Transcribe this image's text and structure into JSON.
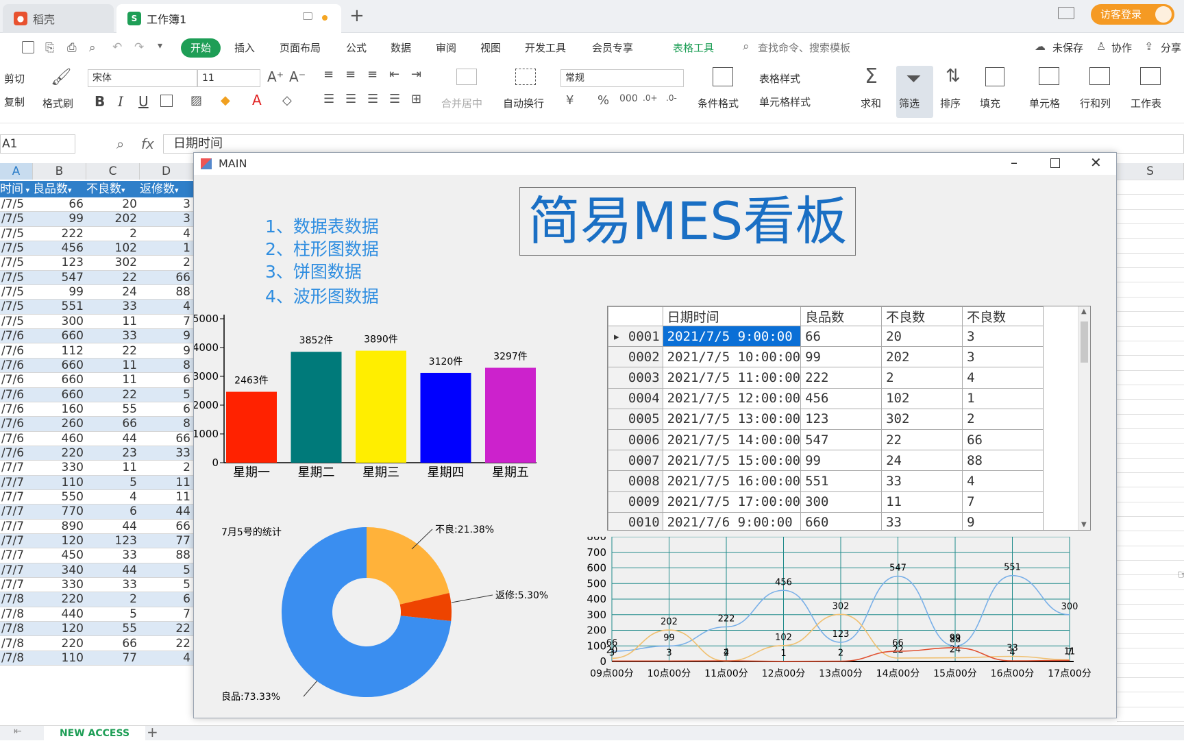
{
  "titlebar": {
    "tab1": "稻壳",
    "tab2": "工作簿1",
    "new_tab": "+",
    "login": "访客登录"
  },
  "menu": {
    "items": [
      "开始",
      "插入",
      "页面布局",
      "公式",
      "数据",
      "审阅",
      "视图",
      "开发工具",
      "会员专享",
      "表格工具"
    ],
    "search": "查找命令、搜索模板",
    "unsaved": "未保存",
    "collab": "协作",
    "share": "分享"
  },
  "toolbar": {
    "cut": "剪切",
    "copy": "复制",
    "format_painter": "格式刷",
    "font": "宋体",
    "size": "11",
    "merge": "合并居中",
    "wrap": "自动换行",
    "number_format": "常规",
    "cond_format": "条件格式",
    "table_style": "表格样式",
    "cell_style": "单元格样式",
    "sum": "求和",
    "filter": "筛选",
    "sort": "排序",
    "fill": "填充",
    "cell": "单元格",
    "rowcol": "行和列",
    "worksheet": "工作表"
  },
  "formula": {
    "cellref": "A1",
    "fx": "fx",
    "content": "日期时间"
  },
  "sheet": {
    "columns": [
      "A",
      "B",
      "C",
      "D"
    ],
    "right_column": "S",
    "headers": [
      "时间",
      "良品数",
      "不良数",
      "返修数"
    ],
    "rows": [
      [
        "/7/5",
        "66",
        "20",
        "3"
      ],
      [
        "/7/5",
        "99",
        "202",
        "3"
      ],
      [
        "/7/5",
        "222",
        "2",
        "4"
      ],
      [
        "/7/5",
        "456",
        "102",
        "1"
      ],
      [
        "/7/5",
        "123",
        "302",
        "2"
      ],
      [
        "/7/5",
        "547",
        "22",
        "66"
      ],
      [
        "/7/5",
        "99",
        "24",
        "88"
      ],
      [
        "/7/5",
        "551",
        "33",
        "4"
      ],
      [
        "/7/5",
        "300",
        "11",
        "7"
      ],
      [
        "/7/6",
        "660",
        "33",
        "9"
      ],
      [
        "/7/6",
        "112",
        "22",
        "9"
      ],
      [
        "/7/6",
        "660",
        "11",
        "8"
      ],
      [
        "/7/6",
        "660",
        "11",
        "6"
      ],
      [
        "/7/6",
        "660",
        "22",
        "5"
      ],
      [
        "/7/6",
        "160",
        "55",
        "6"
      ],
      [
        "/7/6",
        "260",
        "66",
        "8"
      ],
      [
        "/7/6",
        "460",
        "44",
        "66"
      ],
      [
        "/7/6",
        "220",
        "23",
        "33"
      ],
      [
        "/7/7",
        "330",
        "11",
        "2"
      ],
      [
        "/7/7",
        "110",
        "5",
        "11"
      ],
      [
        "/7/7",
        "550",
        "4",
        "11"
      ],
      [
        "/7/7",
        "770",
        "6",
        "44"
      ],
      [
        "/7/7",
        "890",
        "44",
        "66"
      ],
      [
        "/7/7",
        "120",
        "123",
        "77"
      ],
      [
        "/7/7",
        "450",
        "33",
        "88"
      ],
      [
        "/7/7",
        "340",
        "44",
        "5"
      ],
      [
        "/7/7",
        "330",
        "33",
        "5"
      ],
      [
        "/7/8",
        "220",
        "2",
        "6"
      ],
      [
        "/7/8",
        "440",
        "5",
        "7"
      ],
      [
        "/7/8",
        "120",
        "55",
        "22"
      ],
      [
        "/7/8",
        "220",
        "66",
        "22"
      ],
      [
        "/7/8",
        "110",
        "77",
        "4"
      ]
    ],
    "sheet_tab": "NEW ACCESS"
  },
  "window": {
    "title": "MAIN",
    "board_title": "简易MES看板",
    "list": [
      "1、数据表数据",
      "2、柱形图数据",
      "3、饼图数据",
      "4、波形图数据"
    ],
    "grid": {
      "headers": [
        "日期时间",
        "良品数",
        "不良数",
        "不良数"
      ],
      "rows": [
        [
          "0001",
          "2021/7/5  9:00:00",
          "66",
          "20",
          "3"
        ],
        [
          "0002",
          "2021/7/5  10:00:00",
          "99",
          "202",
          "3"
        ],
        [
          "0003",
          "2021/7/5  11:00:00",
          "222",
          "2",
          "4"
        ],
        [
          "0004",
          "2021/7/5  12:00:00",
          "456",
          "102",
          "1"
        ],
        [
          "0005",
          "2021/7/5  13:00:00",
          "123",
          "302",
          "2"
        ],
        [
          "0006",
          "2021/7/5  14:00:00",
          "547",
          "22",
          "66"
        ],
        [
          "0007",
          "2021/7/5  15:00:00",
          "99",
          "24",
          "88"
        ],
        [
          "0008",
          "2021/7/5  16:00:00",
          "551",
          "33",
          "4"
        ],
        [
          "0009",
          "2021/7/5  17:00:00",
          "300",
          "11",
          "7"
        ],
        [
          "0010",
          "2021/7/6  9:00:00",
          "660",
          "33",
          "9"
        ]
      ]
    }
  },
  "chart_data": [
    {
      "type": "bar",
      "categories": [
        "星期一",
        "星期二",
        "星期三",
        "星期四",
        "星期五"
      ],
      "values": [
        2463,
        3852,
        3890,
        3120,
        3297
      ],
      "data_labels": [
        "2463件",
        "3852件",
        "3890件",
        "3120件",
        "3297件"
      ],
      "colors": [
        "#ff2200",
        "#007a7a",
        "#ffee00",
        "#0000ff",
        "#cc22cc"
      ],
      "ylim": [
        0,
        5000
      ],
      "yticks": [
        0,
        1000,
        2000,
        3000,
        4000,
        5000
      ]
    },
    {
      "type": "pie",
      "title": "7月5号的统计",
      "labels": [
        "良品:73.33%",
        "不良:21.38%",
        "返修:5.30%"
      ],
      "values": [
        73.33,
        21.38,
        5.3
      ],
      "colors": [
        "#3a8ef0",
        "#ffb23a",
        "#ee4400"
      ]
    },
    {
      "type": "line",
      "categories": [
        "09点00分",
        "10点00分",
        "11点00分",
        "12点00分",
        "13点00分",
        "14点00分",
        "15点00分",
        "16点00分",
        "17点00分"
      ],
      "ylim": [
        0,
        800
      ],
      "yticks": [
        0,
        100,
        200,
        300,
        400,
        500,
        600,
        700,
        800
      ],
      "series": [
        {
          "values": [
            66,
            99,
            222,
            456,
            123,
            547,
            99,
            551,
            300
          ],
          "color": "#7ab0e8"
        },
        {
          "values": [
            20,
            202,
            2,
            102,
            302,
            22,
            24,
            33,
            11
          ],
          "color": "#f0c070"
        },
        {
          "values": [
            3,
            3,
            4,
            1,
            2,
            66,
            88,
            4,
            7
          ],
          "color": "#e05030"
        }
      ]
    }
  ]
}
